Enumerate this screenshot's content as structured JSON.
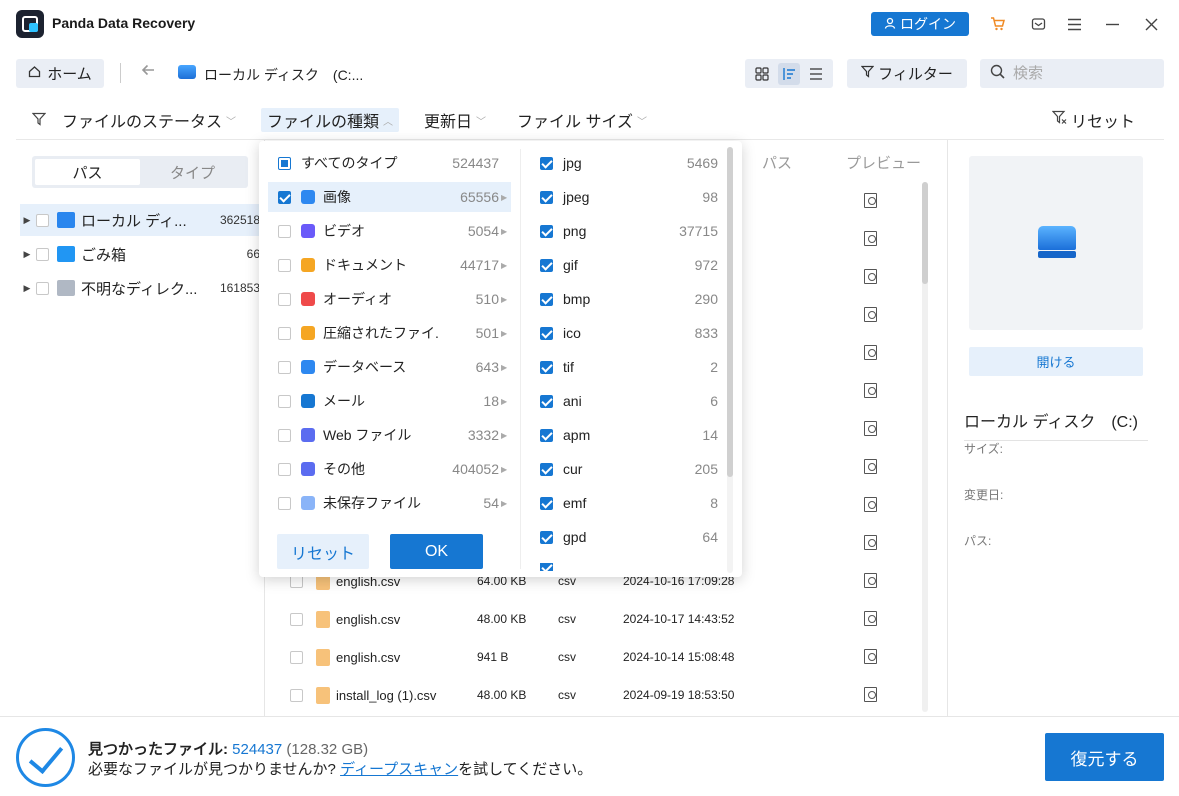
{
  "app": {
    "title": "Panda Data Recovery",
    "login_label": "ログイン"
  },
  "titlebar_icons": [
    "cart-icon",
    "feedback-icon",
    "menu-icon",
    "minimize-icon",
    "close-icon"
  ],
  "nav": {
    "home_label": "ホーム",
    "breadcrumb": "ローカル ディスク　(C:...",
    "filter_label": "フィルター",
    "search_placeholder": "検索"
  },
  "filterbar": {
    "status_label": "ファイルのステータス",
    "type_label": "ファイルの種類",
    "date_label": "更新日",
    "size_label": "ファイル サイズ",
    "reset_label": "リセット"
  },
  "left": {
    "tabs": [
      "パス",
      "タイプ"
    ],
    "tree": [
      {
        "label": "ローカル ディ...",
        "count": "362518",
        "icon": "drive-icon",
        "color": "#2a86ee"
      },
      {
        "label": "ごみ箱",
        "count": "66",
        "icon": "recycle-bin-icon",
        "color": "#2196f3"
      },
      {
        "label": "不明なディレク...",
        "count": "161853",
        "icon": "unknown-folder-icon",
        "color": "#b0b8c4"
      }
    ]
  },
  "table": {
    "col_path": "パス",
    "col_preview": "プレビュー"
  },
  "files": [
    {
      "name": "english.csv",
      "size": "64.00 KB",
      "type": "csv",
      "date": "2024-10-16 17:09:28"
    },
    {
      "name": "english.csv",
      "size": "48.00 KB",
      "type": "csv",
      "date": "2024-10-17 14:43:52"
    },
    {
      "name": "english.csv",
      "size": "941 B",
      "type": "csv",
      "date": "2024-10-14 15:08:48"
    },
    {
      "name": "install_log (1).csv",
      "size": "48.00 KB",
      "type": "csv",
      "date": "2024-09-19 18:53:50"
    }
  ],
  "dropdown": {
    "categories": [
      {
        "label": "すべてのタイプ",
        "count": "524437",
        "icon": "",
        "color": "",
        "state": "partial",
        "arrow": ""
      },
      {
        "label": "画像",
        "count": "65556",
        "icon": "image-icon",
        "color": "#2e88f0",
        "state": "checked",
        "arrow": "▶"
      },
      {
        "label": "ビデオ",
        "count": "5054",
        "icon": "video-icon",
        "color": "#6a5af9",
        "state": "",
        "arrow": "▶"
      },
      {
        "label": "ドキュメント",
        "count": "44717",
        "icon": "document-icon",
        "color": "#f5a623",
        "state": "",
        "arrow": "▶"
      },
      {
        "label": "オーディオ",
        "count": "510",
        "icon": "audio-icon",
        "color": "#ef4a4a",
        "state": "",
        "arrow": "▶"
      },
      {
        "label": "圧縮されたファイ.",
        "count": "501",
        "icon": "archive-icon",
        "color": "#f5a623",
        "state": "",
        "arrow": "▶"
      },
      {
        "label": "データベース",
        "count": "643",
        "icon": "database-icon",
        "color": "#2e88f0",
        "state": "",
        "arrow": "▶"
      },
      {
        "label": "メール",
        "count": "18",
        "icon": "mail-icon",
        "color": "#1677d2",
        "state": "",
        "arrow": "▶"
      },
      {
        "label": "Web ファイル",
        "count": "3332",
        "icon": "web-file-icon",
        "color": "#5b6cf0",
        "state": "",
        "arrow": "▶"
      },
      {
        "label": "その他",
        "count": "404052",
        "icon": "other-icon",
        "color": "#5b6cf0",
        "state": "",
        "arrow": "▶"
      },
      {
        "label": "未保存ファイル",
        "count": "54",
        "icon": "unsaved-file-icon",
        "color": "#8ab4f8",
        "state": "",
        "arrow": "▶"
      }
    ],
    "extensions": [
      {
        "label": "jpg",
        "count": "5469"
      },
      {
        "label": "jpeg",
        "count": "98"
      },
      {
        "label": "png",
        "count": "37715"
      },
      {
        "label": "gif",
        "count": "972"
      },
      {
        "label": "bmp",
        "count": "290"
      },
      {
        "label": "ico",
        "count": "833"
      },
      {
        "label": "tif",
        "count": "2"
      },
      {
        "label": "ani",
        "count": "6"
      },
      {
        "label": "apm",
        "count": "14"
      },
      {
        "label": "cur",
        "count": "205"
      },
      {
        "label": "emf",
        "count": "8"
      },
      {
        "label": "gpd",
        "count": "64"
      }
    ],
    "reset_label": "リセット",
    "ok_label": "OK"
  },
  "right": {
    "open_label": "開ける",
    "title": "ローカル ディスク　(C:)",
    "size_label": "サイズ:",
    "date_label": "変更日:",
    "path_label": "パス:"
  },
  "bottom": {
    "found_label": "見つかったファイル: ",
    "found_count": "524437",
    "found_size": " (128.32 GB)",
    "hint_pre": "必要なファイルが見つかりませんか? ",
    "hint_link": "ディープスキャン",
    "hint_post": "を試してください。",
    "recover_label": "復元する"
  },
  "colors": {
    "accent": "#1677d2",
    "panel_bg": "#f2f4f8",
    "selected_row": "#e6f0fb"
  }
}
